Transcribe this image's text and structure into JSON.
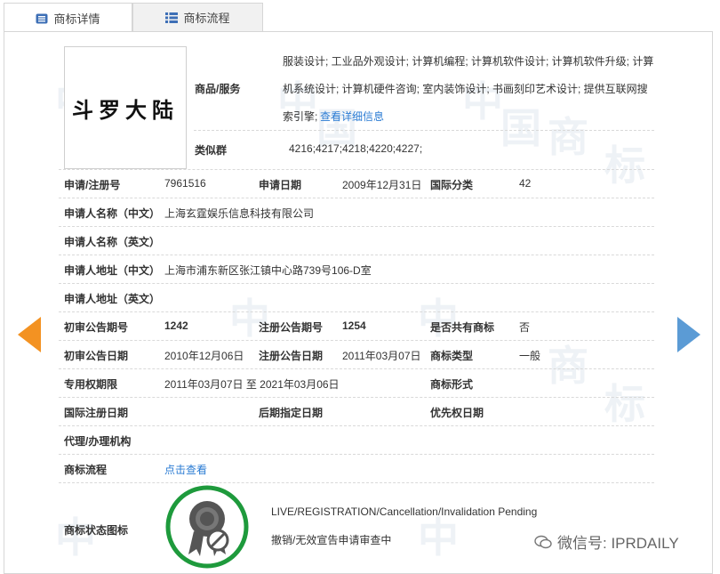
{
  "tabs": [
    {
      "label": "商标详情",
      "icon": "document-icon"
    },
    {
      "label": "商标流程",
      "icon": "list-icon"
    }
  ],
  "watermark_chars": [
    "中",
    "国",
    "商",
    "标"
  ],
  "logo": {
    "text": "斗罗大陆"
  },
  "goods": {
    "label": "商品/服务",
    "lines": [
      "服装设计; 工业品外观设计; 计算机编程; 计算机软件设计; 计算机软件升级; 计算",
      "机系统设计; 计算机硬件咨询; 室内装饰设计; 书画刻印艺术设计; 提供互联网搜",
      "索引擎;"
    ],
    "detail_link": "查看详细信息"
  },
  "similar_group": {
    "label": "类似群",
    "value": "4216;4217;4218;4220;4227;"
  },
  "fields": {
    "reg_no_label": "申请/注册号",
    "reg_no": "7961516",
    "app_date_label": "申请日期",
    "app_date": "2009年12月31日",
    "intl_class_label": "国际分类",
    "intl_class": "42",
    "applicant_cn_label": "申请人名称（中文）",
    "applicant_cn": "上海玄霆娱乐信息科技有限公司",
    "applicant_en_label": "申请人名称（英文）",
    "address_cn_label": "申请人地址（中文）",
    "address_cn": "上海市浦东新区张江镇中心路739号106-D室",
    "address_en_label": "申请人地址（英文）",
    "prelim_no_label": "初审公告期号",
    "prelim_no": "1242",
    "reg_ann_no_label": "注册公告期号",
    "reg_ann_no": "1254",
    "shared_label": "是否共有商标",
    "shared": "否",
    "prelim_date_label": "初审公告日期",
    "prelim_date": "2010年12月06日",
    "reg_ann_date_label": "注册公告日期",
    "reg_ann_date": "2011年03月07日",
    "tm_type_label": "商标类型",
    "tm_type": "一般",
    "exclusive_label": "专用权期限",
    "exclusive": "2011年03月07日 至 2021年03月06日",
    "tm_form_label": "商标形式",
    "intl_reg_date_label": "国际注册日期",
    "later_date_label": "后期指定日期",
    "priority_label": "优先权日期",
    "agency_label": "代理/办理机构",
    "process_label": "商标流程",
    "process_link": "点击查看",
    "status_icon_label": "商标状态图标"
  },
  "status": {
    "en": "LIVE/REGISTRATION/Cancellation/Invalidation Pending",
    "cn": "撤销/无效宣告申请审查中",
    "ring_color": "#1e9a3c"
  },
  "wechat": {
    "text": "微信号: IPRDAILY"
  },
  "colors": {
    "arrow_left": "#f39222",
    "arrow_right": "#5b9bd5",
    "link": "#2a7bd3"
  }
}
